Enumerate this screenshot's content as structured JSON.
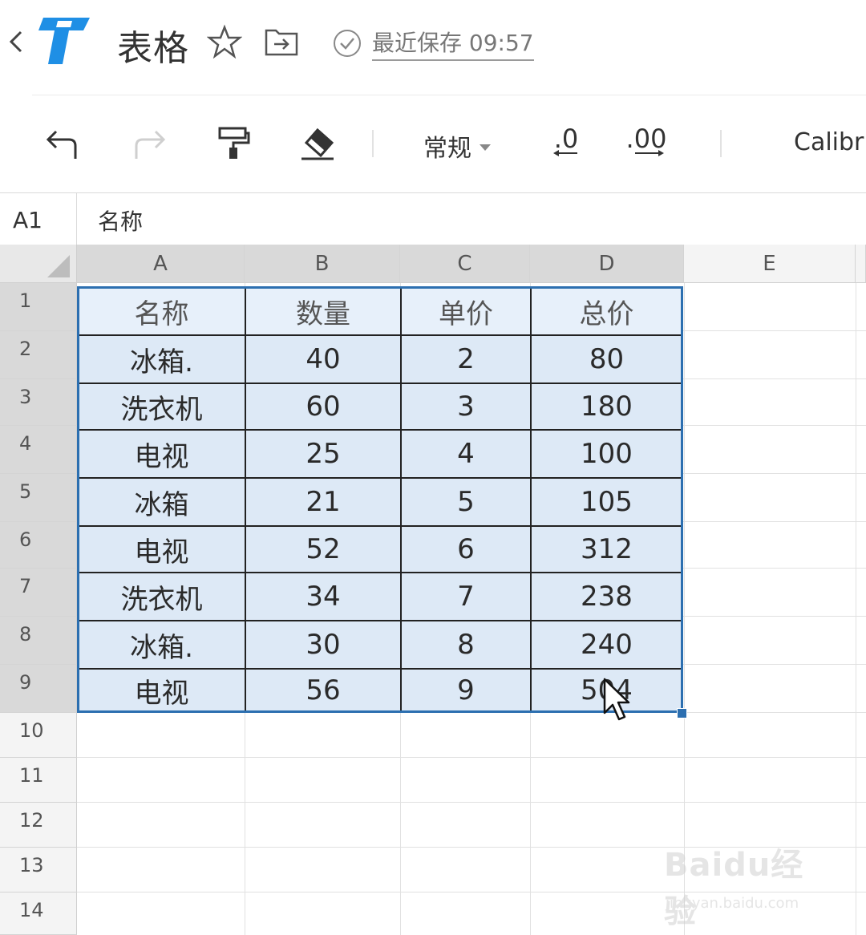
{
  "titlebar": {
    "doc_title": "表格",
    "save_status": "最近保存 09:57"
  },
  "toolbar": {
    "number_format": "常规",
    "decrease_decimal": ".0",
    "increase_decimal": ".00",
    "font_name": "Calibri"
  },
  "formula_bar": {
    "cell_ref": "A1",
    "content": "名称"
  },
  "sheet": {
    "columns": [
      "A",
      "B",
      "C",
      "D",
      "E"
    ],
    "rows": [
      "1",
      "2",
      "3",
      "4",
      "5",
      "6",
      "7",
      "8",
      "9",
      "10",
      "11",
      "12",
      "13",
      "14"
    ],
    "table": [
      [
        "名称",
        "数量",
        "单价",
        "总价"
      ],
      [
        "冰箱.",
        "40",
        "2",
        "80"
      ],
      [
        "洗衣机",
        "60",
        "3",
        "180"
      ],
      [
        "电视",
        "25",
        "4",
        "100"
      ],
      [
        "冰箱",
        "21",
        "5",
        "105"
      ],
      [
        "电视",
        "52",
        "6",
        "312"
      ],
      [
        "洗衣机",
        "34",
        "7",
        "238"
      ],
      [
        "冰箱.",
        "30",
        "8",
        "240"
      ],
      [
        "电视",
        "56",
        "9",
        "504"
      ]
    ],
    "selection": "A1:D9"
  },
  "watermark": {
    "brand": "Baidu经验",
    "url": "jingyan.baidu.com"
  },
  "colors": {
    "selection_border": "#2c6fb0",
    "cell_fill": "#dde9f6",
    "header_selected": "#d9d9d9",
    "logo_blue": "#1f8fe5"
  }
}
